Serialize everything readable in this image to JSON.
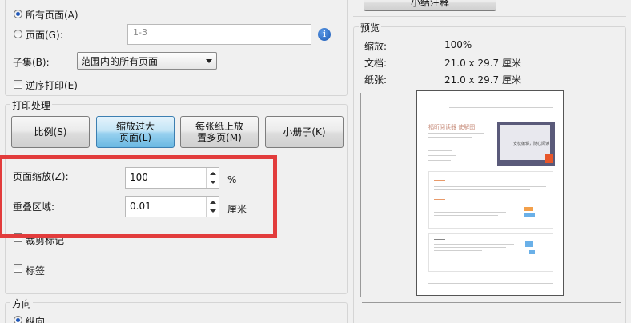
{
  "print_range": {
    "all_pages_label": "所有页面(A)",
    "pages_label": "页面(G):",
    "pages_placeholder": "1-3",
    "subset_label": "子集(B):",
    "subset_value": "范围内的所有页面",
    "reverse_label": "逆序打印(E)"
  },
  "top_button_label": "小结注释",
  "print_handling": {
    "title": "打印处理",
    "buttons": [
      {
        "label": "比例(S)"
      },
      {
        "label": "缩放过大\n页面(L)"
      },
      {
        "label": "每张纸上放\n置多页(M)"
      },
      {
        "label": "小册子(K)"
      }
    ],
    "page_scale_label": "页面缩放(Z):",
    "page_scale_value": "100",
    "page_scale_unit": "%",
    "overlap_label": "重叠区域:",
    "overlap_value": "0.01",
    "overlap_unit": "厘米",
    "crop_marks_label": "裁剪标记",
    "labels_label": "标签"
  },
  "orientation": {
    "title": "方向",
    "portrait_label": "纵向"
  },
  "preview": {
    "title": "预览",
    "scale_label": "缩放:",
    "scale_value": "100%",
    "doc_label": "文档:",
    "doc_value": "21.0 x 29.7 厘米",
    "paper_label": "纸张:",
    "paper_value": "21.0 x 29.7 厘米",
    "thumbnail": {
      "heading": "福昕阅读器 使解图",
      "banner_text": "安枕编辑，随心阅读"
    }
  },
  "colors": {
    "highlight": "#e23c3c",
    "active_button": "#98d1ef",
    "info_icon": "#1d5bb5"
  }
}
